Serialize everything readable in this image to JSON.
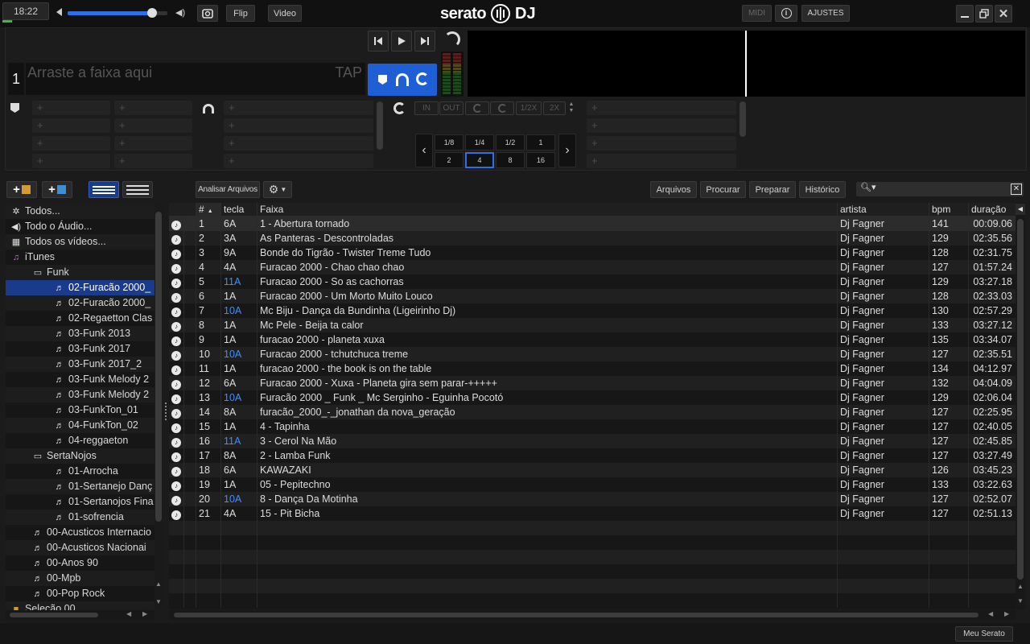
{
  "topbar": {
    "time": "18:22",
    "flip": "Flip",
    "video": "Video",
    "logo": "serato",
    "logo_dj": "DJ",
    "midi": "MIDI",
    "settings": "AJUSTES",
    "volume_fraction": 0.85
  },
  "deck": {
    "number": "1",
    "placeholder": "Arraste a faixa aqui",
    "tap": "TAP"
  },
  "loop": {
    "in": "IN",
    "out": "OUT",
    "half": "1/2X",
    "double": "2X",
    "sizes_top": [
      "1/8",
      "1/4",
      "1/2",
      "1"
    ],
    "sizes_bottom": [
      "2",
      "4",
      "8",
      "16"
    ],
    "selected": "4"
  },
  "toolbar": {
    "analyze": "Analisar Arquivos",
    "files": "Arquivos",
    "browse": "Procurar",
    "prepare": "Preparar",
    "history": "Histórico"
  },
  "tree": [
    {
      "label": "Todos...",
      "icon": "gear-icon",
      "indent": 0
    },
    {
      "label": "Todo o Áudio...",
      "icon": "speaker-icon",
      "indent": 0
    },
    {
      "label": "Todos os vídeos...",
      "icon": "film-icon",
      "indent": 0
    },
    {
      "label": "iTunes",
      "icon": "itunes-icon",
      "indent": 0
    },
    {
      "label": "Funk",
      "icon": "folder-icon",
      "indent": 1
    },
    {
      "label": "02-Furacão 2000_",
      "icon": "playlist-icon",
      "indent": 2,
      "selected": true
    },
    {
      "label": "02-Furacão 2000_",
      "icon": "playlist-icon",
      "indent": 2
    },
    {
      "label": "02-Regaetton Clas",
      "icon": "playlist-icon",
      "indent": 2
    },
    {
      "label": "03-Funk  2013",
      "icon": "playlist-icon",
      "indent": 2
    },
    {
      "label": "03-Funk 2017",
      "icon": "playlist-icon",
      "indent": 2
    },
    {
      "label": "03-Funk 2017_2",
      "icon": "playlist-icon",
      "indent": 2
    },
    {
      "label": "03-Funk Melody 2",
      "icon": "playlist-icon",
      "indent": 2
    },
    {
      "label": "03-Funk Melody 2",
      "icon": "playlist-icon",
      "indent": 2
    },
    {
      "label": "03-FunkTon_01",
      "icon": "playlist-icon",
      "indent": 2
    },
    {
      "label": "04-FunkTon_02",
      "icon": "playlist-icon",
      "indent": 2
    },
    {
      "label": "04-reggaeton",
      "icon": "playlist-icon",
      "indent": 2
    },
    {
      "label": "SertaNojos",
      "icon": "folder-icon",
      "indent": 1
    },
    {
      "label": "01-Arrocha",
      "icon": "playlist-icon",
      "indent": 2
    },
    {
      "label": "01-Sertanejo Danç",
      "icon": "playlist-icon",
      "indent": 2
    },
    {
      "label": "01-Sertanojos Fina",
      "icon": "playlist-icon",
      "indent": 2
    },
    {
      "label": "01-sofrencia",
      "icon": "playlist-icon",
      "indent": 2
    },
    {
      "label": "00-Acusticos Internacio",
      "icon": "playlist-icon",
      "indent": 1
    },
    {
      "label": "00-Acusticos Nacionai",
      "icon": "playlist-icon",
      "indent": 1
    },
    {
      "label": "00-Anos 90",
      "icon": "playlist-icon",
      "indent": 1
    },
    {
      "label": "00-Mpb",
      "icon": "playlist-icon",
      "indent": 1
    },
    {
      "label": "00-Pop Rock",
      "icon": "playlist-icon",
      "indent": 1
    },
    {
      "label": "Seleção 00",
      "icon": "crate-icon",
      "indent": 0
    }
  ],
  "columns": {
    "num": "#",
    "key": "tecla",
    "track": "Faixa",
    "artist": "artista",
    "bpm": "bpm",
    "duration": "duração"
  },
  "tracks": [
    {
      "n": "1",
      "key": "6A",
      "title": "1 - Abertura tornado",
      "artist": "Dj Fagner",
      "bpm": "141",
      "dur": "00:09.06"
    },
    {
      "n": "2",
      "key": "3A",
      "title": "As Panteras - Descontroladas",
      "artist": "Dj Fagner",
      "bpm": "129",
      "dur": "02:35.56"
    },
    {
      "n": "3",
      "key": "9A",
      "title": "Bonde do Tigrão - Twister Treme Tudo",
      "artist": "Dj Fagner",
      "bpm": "128",
      "dur": "02:31.75"
    },
    {
      "n": "4",
      "key": "4A",
      "title": "Furacao 2000 - Chao chao chao",
      "artist": "Dj Fagner",
      "bpm": "127",
      "dur": "01:57.24"
    },
    {
      "n": "5",
      "key": "11A",
      "title": "Furacao 2000 - So as cachorras",
      "artist": "Dj Fagner",
      "bpm": "129",
      "dur": "03:27.18",
      "blue": true
    },
    {
      "n": "6",
      "key": "1A",
      "title": "Furacao 2000 - Um Morto Muito Louco",
      "artist": "Dj Fagner",
      "bpm": "128",
      "dur": "02:33.03"
    },
    {
      "n": "7",
      "key": "10A",
      "title": "Mc Biju - Dança da Bundinha (Ligeirinho Dj)",
      "artist": "Dj Fagner",
      "bpm": "130",
      "dur": "02:57.29",
      "blue": true
    },
    {
      "n": "8",
      "key": "1A",
      "title": "Mc Pele - Beija ta calor",
      "artist": "Dj Fagner",
      "bpm": "133",
      "dur": "03:27.12"
    },
    {
      "n": "9",
      "key": "1A",
      "title": "furacao 2000 - planeta xuxa",
      "artist": "Dj Fagner",
      "bpm": "135",
      "dur": "03:34.07"
    },
    {
      "n": "10",
      "key": "10A",
      "title": "Furacao 2000 - tchutchuca treme",
      "artist": "Dj Fagner",
      "bpm": "127",
      "dur": "02:35.51",
      "blue": true
    },
    {
      "n": "11",
      "key": "1A",
      "title": "furacao 2000 - the book is on the table",
      "artist": "Dj Fagner",
      "bpm": "134",
      "dur": "04:12.97"
    },
    {
      "n": "12",
      "key": "6A",
      "title": "Furacao 2000 - Xuxa - Planeta gira sem parar-+++++",
      "artist": "Dj Fagner",
      "bpm": "132",
      "dur": "04:04.09"
    },
    {
      "n": "13",
      "key": "10A",
      "title": "Furacão 2000 _ Funk _ Mc Serginho - Eguinha Pocotó",
      "artist": "Dj Fagner",
      "bpm": "129",
      "dur": "02:06.04",
      "blue": true
    },
    {
      "n": "14",
      "key": "8A",
      "title": "furacão_2000_-_jonathan da nova_geração",
      "artist": "Dj Fagner",
      "bpm": "127",
      "dur": "02:25.95"
    },
    {
      "n": "15",
      "key": "1A",
      "title": "4 - Tapinha",
      "artist": "Dj Fagner",
      "bpm": "127",
      "dur": "02:40.05"
    },
    {
      "n": "16",
      "key": "11A",
      "title": "3 - Cerol Na Mão",
      "artist": "Dj Fagner",
      "bpm": "127",
      "dur": "02:45.85",
      "blue": true
    },
    {
      "n": "17",
      "key": "8A",
      "title": "2 - Lamba Funk",
      "artist": "Dj Fagner",
      "bpm": "127",
      "dur": "03:27.49"
    },
    {
      "n": "18",
      "key": "6A",
      "title": "KAWAZAKI",
      "artist": "Dj Fagner",
      "bpm": "126",
      "dur": "03:45.23"
    },
    {
      "n": "19",
      "key": "1A",
      "title": "05 - Pepitechno",
      "artist": "Dj Fagner",
      "bpm": "133",
      "dur": "03:22.63"
    },
    {
      "n": "20",
      "key": "10A",
      "title": "8 - Dança Da Motinha",
      "artist": "Dj Fagner",
      "bpm": "127",
      "dur": "02:52.07",
      "blue": true
    },
    {
      "n": "21",
      "key": "4A",
      "title": "15 - Pit Bicha",
      "artist": "Dj Fagner",
      "bpm": "127",
      "dur": "02:51.13"
    }
  ],
  "footer": {
    "my_serato": "Meu Serato"
  },
  "colors": {
    "accent": "#1a3b8c",
    "deck_blue": "#1f5fd6",
    "key_blue": "#3d8eff"
  }
}
